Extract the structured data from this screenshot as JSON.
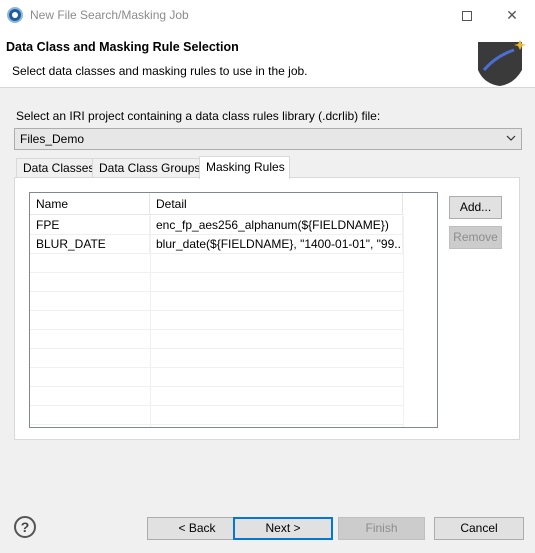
{
  "window": {
    "title": "New File Search/Masking Job",
    "minimize_glyph": "—",
    "close_glyph": "✕"
  },
  "header": {
    "title": "Data Class and Masking Rule Selection",
    "description": "Select data classes and masking rules to use in the job."
  },
  "project": {
    "label": "Select an IRI project containing a data class rules library (.dcrlib) file:",
    "selected": "Files_Demo"
  },
  "tabs": [
    {
      "label": "Data Classes",
      "active": false
    },
    {
      "label": "Data Class Groups",
      "active": false
    },
    {
      "label": "Masking Rules",
      "active": true
    }
  ],
  "table": {
    "columns": [
      "Name",
      "Detail"
    ],
    "rows": [
      {
        "name": "FPE",
        "detail": "enc_fp_aes256_alphanum(${FIELDNAME})"
      },
      {
        "name": "BLUR_DATE",
        "detail": "blur_date(${FIELDNAME}, \"1400-01-01\", \"99..."
      }
    ]
  },
  "side_buttons": {
    "add_label": "Add...",
    "remove_label": "Remove"
  },
  "footer": {
    "help_glyph": "?",
    "back_label": "< Back",
    "next_label": "Next >",
    "finish_label": "Finish",
    "cancel_label": "Cancel"
  },
  "colors": {
    "accent": "#0078d7",
    "title_text": "#8c8c8c",
    "dialog_bg": "#f0f0f0"
  }
}
